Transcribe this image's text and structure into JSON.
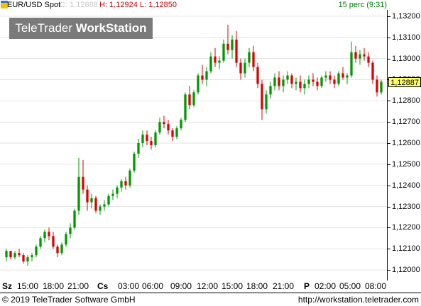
{
  "header": {
    "symbol": "EUR/USD Spot",
    "close_label": "C: 1,12888",
    "high_label": "H: 1,12924",
    "low_label": "L: 1,12850",
    "period_label": "15 perc (9:31)"
  },
  "watermark": {
    "brand_regular": "TeleTrader ",
    "brand_bold": "WorkStation"
  },
  "colors": {
    "up": "#009900",
    "down": "#e00000",
    "grid": "#c8c8c8",
    "last_price_bg": "#ffff66"
  },
  "price_axis": {
    "labels": [
      "1,13200",
      "1,13100",
      "1,13000",
      "1,12900",
      "1,12800",
      "1,12700",
      "1,12600",
      "1,12500",
      "1,12400",
      "1,12300",
      "1,12200",
      "1,12100",
      "1,12000"
    ],
    "last_price": "1,12887"
  },
  "time_axis": {
    "labels": [
      {
        "text": "Sz",
        "bold": true
      },
      {
        "text": "15:00"
      },
      {
        "text": "18:00"
      },
      {
        "text": "21:00"
      },
      {
        "text": "Cs",
        "bold": true
      },
      {
        "text": "03:00"
      },
      {
        "text": "06:00"
      },
      {
        "text": "09:00"
      },
      {
        "text": "12:00"
      },
      {
        "text": "15:00"
      },
      {
        "text": "18:00"
      },
      {
        "text": "21:00"
      },
      {
        "text": "P",
        "bold": true
      },
      {
        "text": "02:00"
      },
      {
        "text": "05:00"
      },
      {
        "text": "08:00"
      }
    ]
  },
  "footer": {
    "copyright": "© 2019 TeleTrader Software GmbH",
    "url": "http://workstation.teletrader.com"
  },
  "chart_data": {
    "type": "candlestick",
    "ylim": [
      1.1195,
      1.1323
    ],
    "candles": [
      [
        1.1206,
        1.121,
        1.1204,
        1.1209
      ],
      [
        1.1209,
        1.1209,
        1.1205,
        1.1206
      ],
      [
        1.1206,
        1.1209,
        1.1205,
        1.1208
      ],
      [
        1.1208,
        1.121,
        1.1206,
        1.1207
      ],
      [
        1.1207,
        1.1208,
        1.1203,
        1.1204
      ],
      [
        1.1204,
        1.1207,
        1.1202,
        1.1206
      ],
      [
        1.1206,
        1.1208,
        1.1204,
        1.1207
      ],
      [
        1.1207,
        1.1212,
        1.1206,
        1.1211
      ],
      [
        1.1211,
        1.1216,
        1.121,
        1.1215
      ],
      [
        1.1215,
        1.1219,
        1.1213,
        1.1218
      ],
      [
        1.1218,
        1.122,
        1.1214,
        1.1216
      ],
      [
        1.1216,
        1.1218,
        1.121,
        1.1211
      ],
      [
        1.1211,
        1.1212,
        1.1206,
        1.1208
      ],
      [
        1.1208,
        1.1213,
        1.1207,
        1.1212
      ],
      [
        1.1212,
        1.1218,
        1.1211,
        1.1217
      ],
      [
        1.1217,
        1.1222,
        1.1215,
        1.122
      ],
      [
        1.122,
        1.1229,
        1.1219,
        1.1228
      ],
      [
        1.1228,
        1.1253,
        1.1226,
        1.1244
      ],
      [
        1.1244,
        1.1252,
        1.1236,
        1.1238
      ],
      [
        1.1238,
        1.124,
        1.1228,
        1.1232
      ],
      [
        1.1232,
        1.1236,
        1.1229,
        1.1234
      ],
      [
        1.1234,
        1.1235,
        1.1227,
        1.1228
      ],
      [
        1.1228,
        1.1231,
        1.1226,
        1.123
      ],
      [
        1.123,
        1.1233,
        1.1228,
        1.1231
      ],
      [
        1.1231,
        1.1236,
        1.123,
        1.1235
      ],
      [
        1.1235,
        1.1238,
        1.1233,
        1.1236
      ],
      [
        1.1236,
        1.124,
        1.1234,
        1.1239
      ],
      [
        1.1239,
        1.1243,
        1.1237,
        1.1242
      ],
      [
        1.1242,
        1.1244,
        1.1238,
        1.124
      ],
      [
        1.124,
        1.1248,
        1.1239,
        1.1247
      ],
      [
        1.1247,
        1.1256,
        1.1246,
        1.1255
      ],
      [
        1.1255,
        1.1262,
        1.1253,
        1.126
      ],
      [
        1.126,
        1.1266,
        1.1258,
        1.1264
      ],
      [
        1.1264,
        1.1266,
        1.1259,
        1.1261
      ],
      [
        1.1261,
        1.1263,
        1.1257,
        1.1259
      ],
      [
        1.1259,
        1.1266,
        1.1258,
        1.1265
      ],
      [
        1.1265,
        1.1272,
        1.1264,
        1.127
      ],
      [
        1.127,
        1.1273,
        1.1267,
        1.1269
      ],
      [
        1.1269,
        1.1271,
        1.1264,
        1.1266
      ],
      [
        1.1266,
        1.1267,
        1.1261,
        1.1263
      ],
      [
        1.1263,
        1.1268,
        1.1262,
        1.1267
      ],
      [
        1.1267,
        1.1272,
        1.1266,
        1.1271
      ],
      [
        1.1271,
        1.1284,
        1.127,
        1.1283
      ],
      [
        1.1283,
        1.1287,
        1.1276,
        1.1278
      ],
      [
        1.1278,
        1.1285,
        1.1277,
        1.1284
      ],
      [
        1.1284,
        1.1293,
        1.1283,
        1.1292
      ],
      [
        1.1292,
        1.1297,
        1.1288,
        1.129
      ],
      [
        1.129,
        1.1296,
        1.1287,
        1.1294
      ],
      [
        1.1294,
        1.1303,
        1.1293,
        1.1301
      ],
      [
        1.1301,
        1.1305,
        1.1296,
        1.1298
      ],
      [
        1.1298,
        1.1301,
        1.1295,
        1.1299
      ],
      [
        1.1299,
        1.1309,
        1.1298,
        1.1307
      ],
      [
        1.1307,
        1.1316,
        1.1302,
        1.1304
      ],
      [
        1.1304,
        1.1311,
        1.13,
        1.1309
      ],
      [
        1.1309,
        1.1313,
        1.1296,
        1.1298
      ],
      [
        1.1298,
        1.13,
        1.129,
        1.1293
      ],
      [
        1.1293,
        1.13,
        1.1291,
        1.1298
      ],
      [
        1.1298,
        1.1305,
        1.1296,
        1.1303
      ],
      [
        1.1303,
        1.1306,
        1.1294,
        1.1296
      ],
      [
        1.1296,
        1.1298,
        1.1286,
        1.1288
      ],
      [
        1.1288,
        1.129,
        1.1271,
        1.1276
      ],
      [
        1.1276,
        1.1285,
        1.1274,
        1.1283
      ],
      [
        1.1283,
        1.1289,
        1.1281,
        1.1287
      ],
      [
        1.1287,
        1.1293,
        1.1285,
        1.1291
      ],
      [
        1.1291,
        1.1294,
        1.1285,
        1.1287
      ],
      [
        1.1287,
        1.1292,
        1.1284,
        1.129
      ],
      [
        1.129,
        1.1294,
        1.1288,
        1.1292
      ],
      [
        1.1292,
        1.1293,
        1.1286,
        1.1288
      ],
      [
        1.1288,
        1.1291,
        1.1285,
        1.1289
      ],
      [
        1.1289,
        1.1292,
        1.1284,
        1.1286
      ],
      [
        1.1286,
        1.129,
        1.1283,
        1.1288
      ],
      [
        1.1288,
        1.1292,
        1.1286,
        1.129
      ],
      [
        1.129,
        1.1293,
        1.1287,
        1.1289
      ],
      [
        1.1289,
        1.1291,
        1.1285,
        1.1287
      ],
      [
        1.1287,
        1.1292,
        1.1286,
        1.1291
      ],
      [
        1.1291,
        1.1294,
        1.1289,
        1.1292
      ],
      [
        1.1292,
        1.1294,
        1.1288,
        1.129
      ],
      [
        1.129,
        1.1292,
        1.1286,
        1.1288
      ],
      [
        1.1288,
        1.1294,
        1.1287,
        1.1293
      ],
      [
        1.1293,
        1.1296,
        1.129,
        1.1291
      ],
      [
        1.1291,
        1.1293,
        1.1288,
        1.1292
      ],
      [
        1.1292,
        1.1308,
        1.1291,
        1.1303
      ],
      [
        1.1303,
        1.1306,
        1.1298,
        1.13
      ],
      [
        1.13,
        1.1304,
        1.1297,
        1.1302
      ],
      [
        1.1302,
        1.1305,
        1.1299,
        1.1301
      ],
      [
        1.1301,
        1.1303,
        1.1296,
        1.1298
      ],
      [
        1.1298,
        1.1299,
        1.1288,
        1.129
      ],
      [
        1.129,
        1.1292,
        1.1282,
        1.1284
      ],
      [
        1.1284,
        1.129,
        1.1283,
        1.1289
      ]
    ]
  }
}
